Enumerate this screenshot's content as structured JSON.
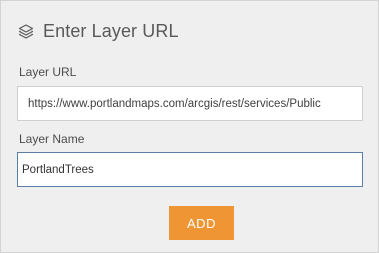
{
  "header": {
    "icon": "layers-icon",
    "title": "Enter Layer URL"
  },
  "form": {
    "url_label": "Layer URL",
    "url_value": "https://www.portlandmaps.com/arcgis/rest/services/Public",
    "name_label": "Layer Name",
    "name_value": "PortlandTrees",
    "add_label": "ADD"
  },
  "colors": {
    "accent": "#ef9533",
    "focus_border": "#5b7ea4",
    "panel_bg": "#efefef"
  }
}
